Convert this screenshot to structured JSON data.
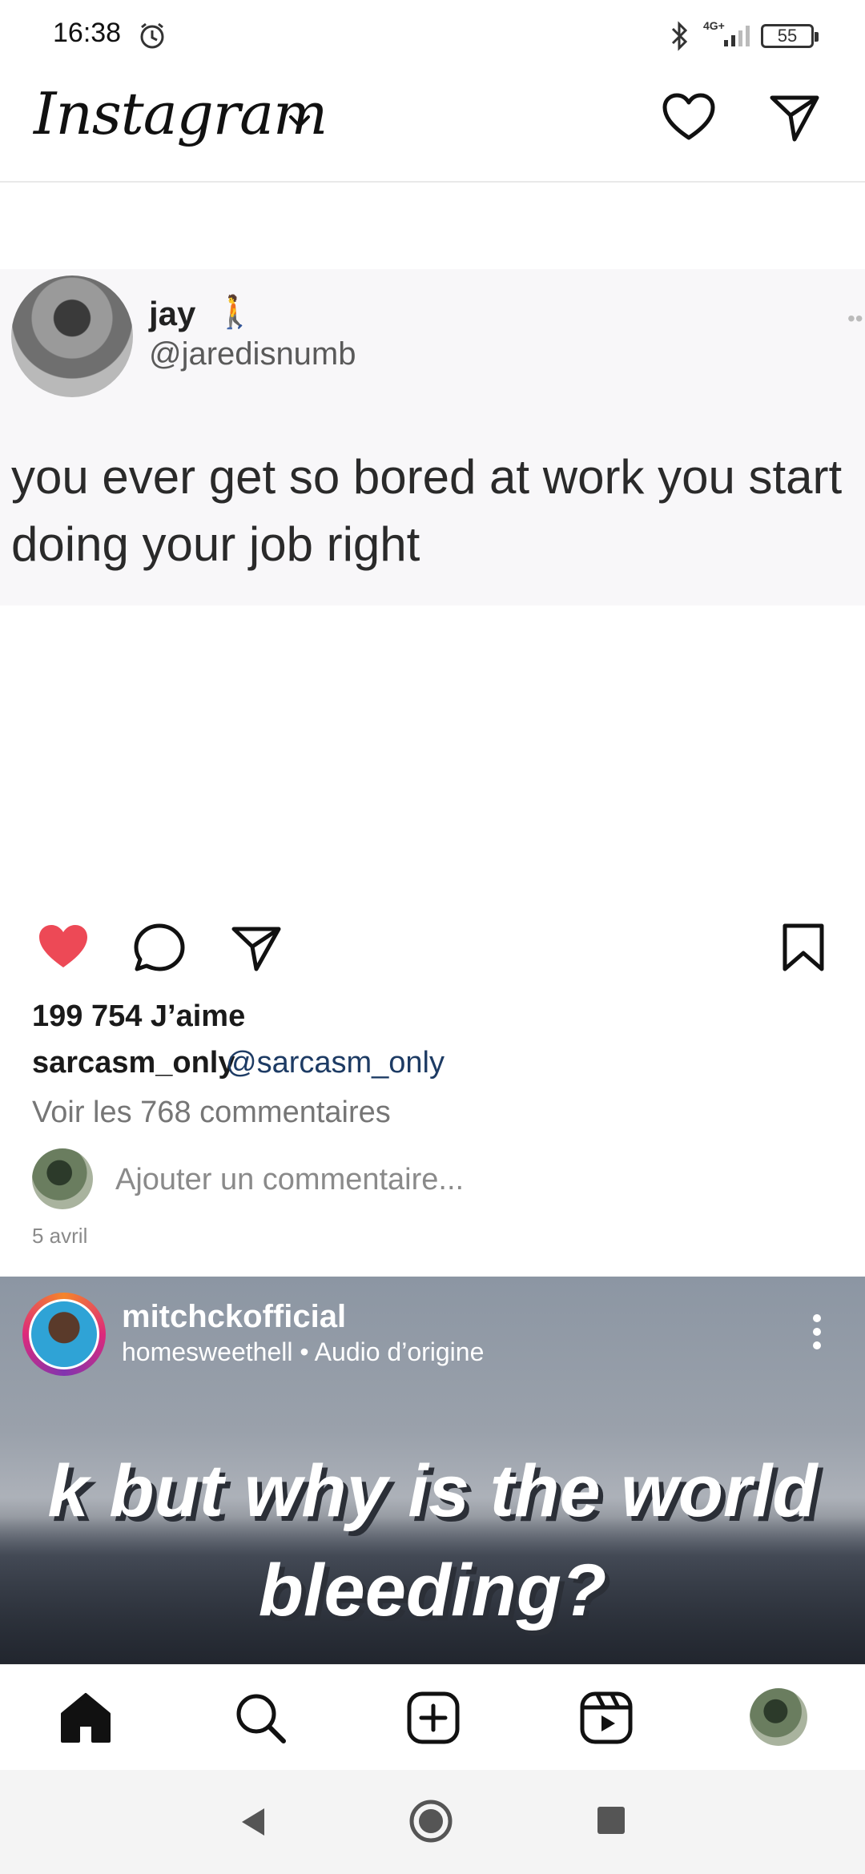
{
  "status_bar": {
    "time": "16:38",
    "network": "4G+",
    "battery": "55"
  },
  "top_bar": {
    "logo": "Instagram"
  },
  "post": {
    "tweet": {
      "name": "jay",
      "emoji": "🚶",
      "handle": "@jaredisnumb",
      "text": "you ever get so bored at work you start doing your job right"
    },
    "liked": true,
    "likes_text": "199 754 J’aime",
    "caption_user": "sarcasm_only",
    "caption_mention": "@sarcasm_only",
    "view_comments": "Voir les 768 commentaires",
    "add_comment_placeholder": "Ajouter un commentaire...",
    "date": "5 avril"
  },
  "reel": {
    "username": "mitchckofficial",
    "audio": "homesweethell • Audio d’origine",
    "overlay_text": "k but why is the world bleeding?"
  },
  "colors": {
    "like_red": "#ed4956",
    "mention_blue": "#1d3b64"
  }
}
